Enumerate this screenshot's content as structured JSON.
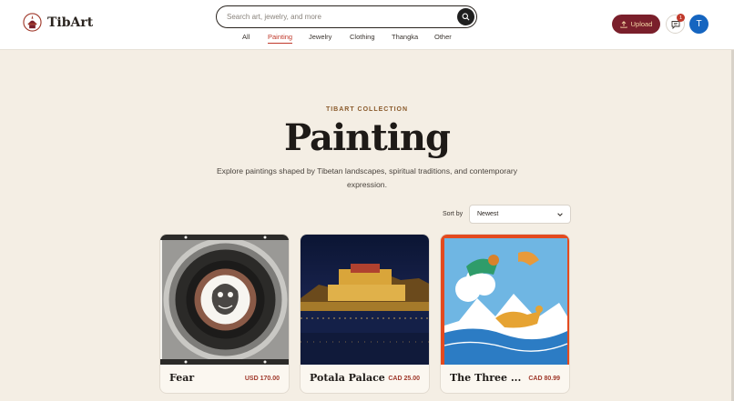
{
  "brand": {
    "name": "TibArt"
  },
  "search": {
    "placeholder": "Search art, jewelry, and more"
  },
  "nav": {
    "items": [
      "All",
      "Painting",
      "Jewelry",
      "Clothing",
      "Thangka",
      "Other"
    ],
    "active": "Painting"
  },
  "header": {
    "upload_label": "Upload",
    "notification_count": "1",
    "avatar_initial": "T"
  },
  "hero": {
    "eyebrow": "TIBART COLLECTION",
    "title": "Painting",
    "subtitle": "Explore paintings shaped by Tibetan landscapes, spiritual traditions, and contemporary expression."
  },
  "sort": {
    "label": "Sort by",
    "value": "Newest"
  },
  "products": [
    {
      "title": "Fear",
      "price": "USD 170.00"
    },
    {
      "title": "Potala Palace",
      "price": "CAD 25.00"
    },
    {
      "title": "The Three ...",
      "price": "CAD 80.99"
    }
  ],
  "colors": {
    "accent": "#7a1f2b",
    "active_nav": "#c0392b",
    "background": "#f4eee4"
  }
}
